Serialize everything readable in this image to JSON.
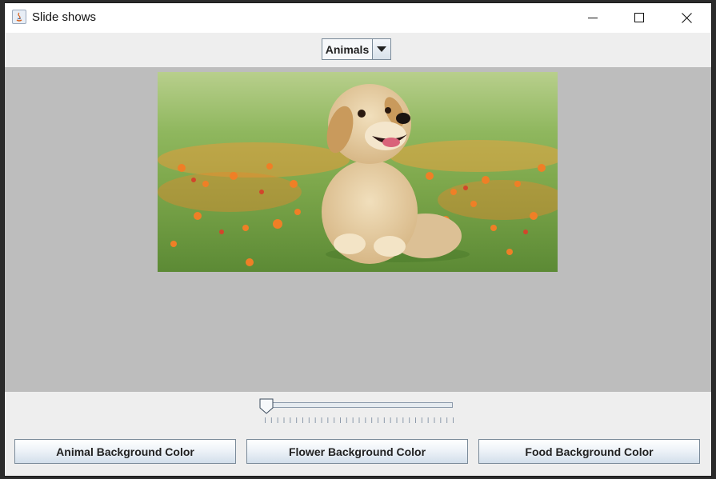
{
  "window": {
    "title": "Slide shows",
    "controls": {
      "minimize": "minimize-icon",
      "maximize": "maximize-icon",
      "close": "close-icon"
    }
  },
  "category_select": {
    "selected": "Animals"
  },
  "slideshow": {
    "image": "golden retriever puppy sitting in grass with orange flowers",
    "background_color": "#bdbdbd",
    "slider_value": 0
  },
  "buttons": {
    "animal": "Animal Background Color",
    "flower": "Flower Background Color",
    "food": "Food Background Color"
  }
}
